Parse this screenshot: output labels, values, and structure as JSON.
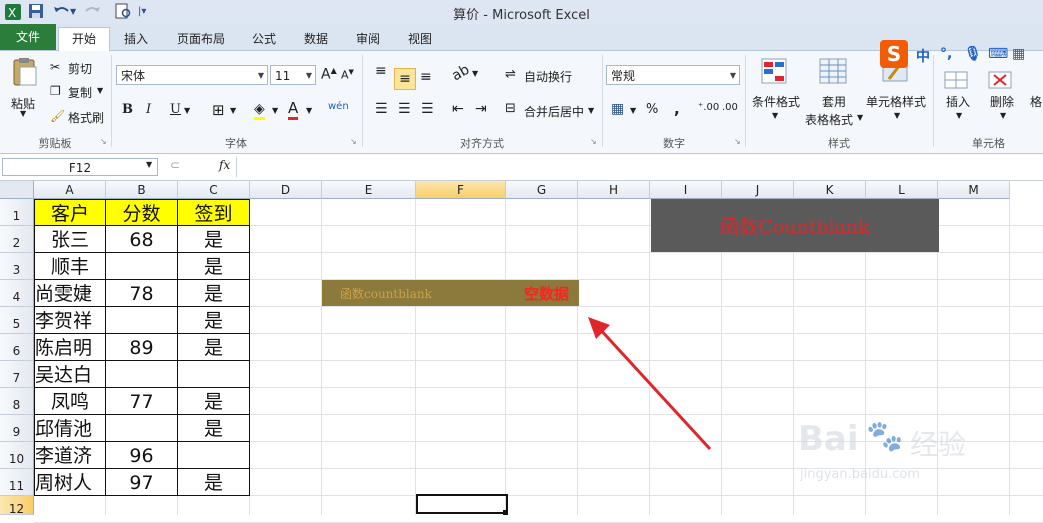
{
  "window": {
    "title": "算价 - Microsoft Excel"
  },
  "quick_access": {
    "save_icon": "save-icon",
    "undo_icon": "undo-icon",
    "redo_icon": "redo-icon",
    "print_preview_icon": "print-preview-icon"
  },
  "tabs": [
    "文件",
    "开始",
    "插入",
    "页面布局",
    "公式",
    "数据",
    "审阅",
    "视图"
  ],
  "ribbon": {
    "clipboard": {
      "label": "剪贴板",
      "paste": "粘贴",
      "cut": "剪切",
      "copy": "复制",
      "format_painter": "格式刷"
    },
    "font": {
      "label": "字体",
      "font_name": "宋体",
      "font_size": "11",
      "bold": "B",
      "italic": "I",
      "underline": "U"
    },
    "alignment": {
      "label": "对齐方式",
      "wrap_text": "自动换行",
      "merge_center": "合并后居中"
    },
    "number": {
      "label": "数字",
      "format": "常规",
      "percent": "%",
      "comma": ","
    },
    "styles": {
      "label": "样式",
      "conditional": "条件格式",
      "table_format_1": "套用",
      "table_format_2": "表格格式",
      "cell_styles": "单元格样式"
    },
    "cells": {
      "label": "单元格",
      "insert": "插入",
      "delete": "删除",
      "format": "格"
    }
  },
  "ime": {
    "logo": "S",
    "mode": "中"
  },
  "formula_bar": {
    "name_box": "F12",
    "fx": "fx",
    "value": ""
  },
  "sheet": {
    "columns": [
      "A",
      "B",
      "C",
      "D",
      "E",
      "F",
      "G",
      "H",
      "I",
      "J",
      "K",
      "L",
      "M"
    ],
    "rows": [
      "1",
      "2",
      "3",
      "4",
      "5",
      "6",
      "7",
      "8",
      "9",
      "10",
      "11",
      "12"
    ],
    "selected_cell": "F12",
    "table": {
      "header": [
        "客户",
        "分数",
        "签到"
      ],
      "rows": [
        [
          "张三",
          "68",
          "是"
        ],
        [
          "顺丰",
          "",
          "是"
        ],
        [
          "尚雯婕",
          "78",
          "是"
        ],
        [
          "李贺祥",
          "",
          "是"
        ],
        [
          "陈启明",
          "89",
          "是"
        ],
        [
          "吴达白",
          "",
          ""
        ],
        [
          "凤鸣",
          "77",
          "是"
        ],
        [
          "邱倩池",
          "",
          "是"
        ],
        [
          "李道济",
          "96",
          ""
        ],
        [
          "周树人",
          "97",
          "是"
        ]
      ]
    },
    "banner": {
      "text": "函数Countblank",
      "bg": "#5a5a5a",
      "color": "#e0262a"
    },
    "label_bar": {
      "left_text": "函数countblank",
      "right_text": "空数据",
      "bg": "#8c7a3c",
      "left_color": "#c8a24a",
      "right_color": "#ff2020"
    }
  },
  "watermark": {
    "brand": "Bai",
    "brand_cn": "经验",
    "url": "jingyan.baidu.com"
  },
  "colors": {
    "header_fill": "#ffff00",
    "accent": "#2a7d3a",
    "arrow": "#e0262a"
  }
}
